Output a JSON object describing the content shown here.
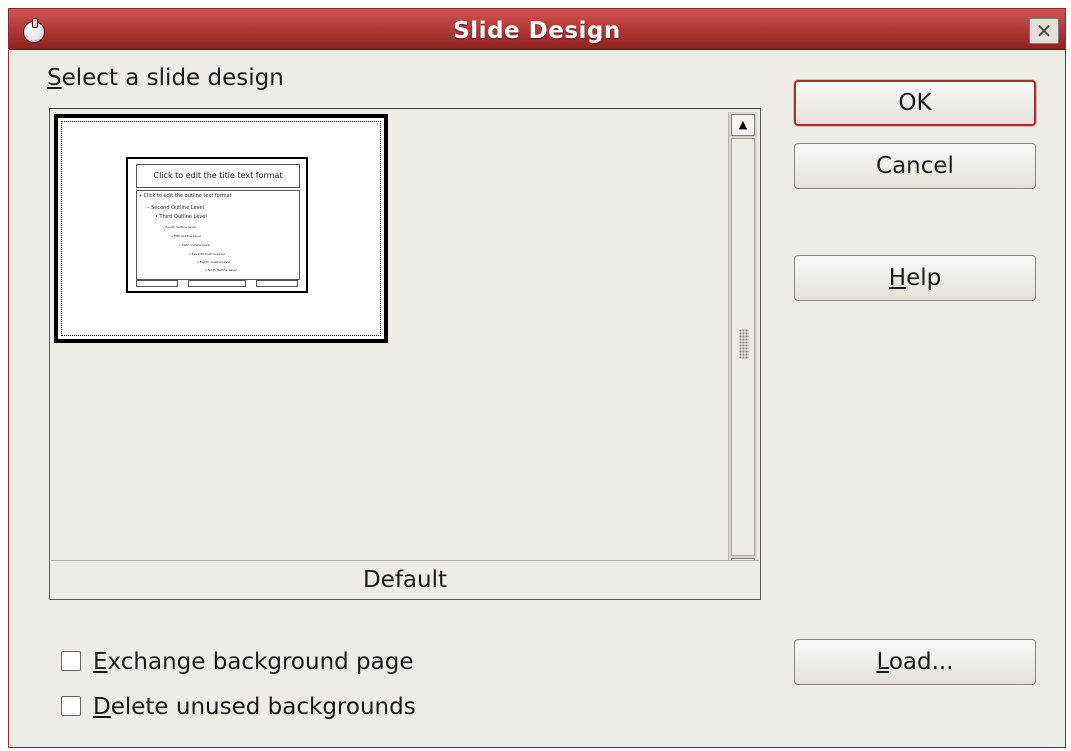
{
  "window": {
    "title": "Slide Design",
    "close_symbol": "✕"
  },
  "list": {
    "label_prefix": "S",
    "label_rest": "elect a slide design",
    "selected_caption": "Default",
    "preview": {
      "title_placeholder": "Click to edit the title text format",
      "outline_lines": [
        "• Click to edit the outline text format",
        "– Second Outline Level",
        "• Third Outline Level",
        "– Fourth Outline Level",
        "» Fifth Outline Level",
        "» Sixth Outline Level",
        "» Seventh Outline Level",
        "» Eighth Outline Level",
        "» Ninth Outline Level"
      ]
    }
  },
  "buttons": {
    "ok": "OK",
    "cancel": "Cancel",
    "help_mn": "H",
    "help_rest": "elp",
    "load_mn": "L",
    "load_rest": "oad..."
  },
  "options": {
    "exchange_mn": "E",
    "exchange_rest": "xchange background page",
    "exchange_checked": false,
    "delete_mn": "D",
    "delete_rest": "elete unused backgrounds",
    "delete_checked": false
  },
  "colors": {
    "titlebar": "#b53a3a",
    "dialog_bg": "#efebe7",
    "default_button_border": "#a53030"
  }
}
